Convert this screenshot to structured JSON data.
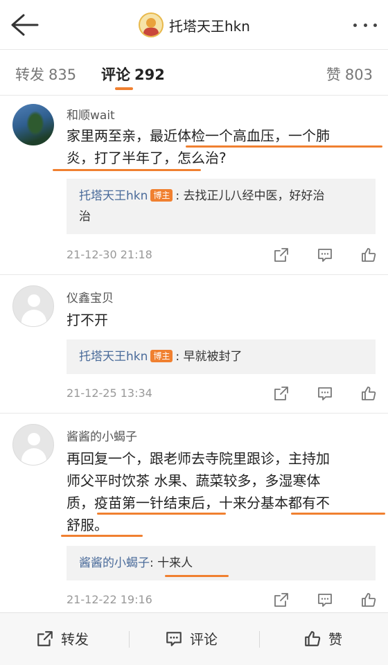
{
  "header": {
    "title": "托塔天王hkn",
    "back_icon": "back-arrow-icon",
    "more_icon": "more-dots-icon"
  },
  "tabs": [
    {
      "label": "转发",
      "count": "835"
    },
    {
      "label": "评论",
      "count": "292"
    },
    {
      "label": "赞",
      "count": "803"
    }
  ],
  "comments": [
    {
      "user": "和顺wait",
      "text_l1": "家里两至亲，最近体检一个高血压，一个肺",
      "text_l2": "炎，打了半年了，怎么治?",
      "reply_name": "托塔天王hkn",
      "reply_badge": "博主",
      "reply_text_l1": ": 去找正儿八经中医，好好治",
      "reply_text_l2": "治",
      "time": "21-12-30 21:18"
    },
    {
      "user": "仪鑫宝贝",
      "text_l1": "打不开",
      "reply_name": "托塔天王hkn",
      "reply_badge": "博主",
      "reply_text_l1": ": 早就被封了",
      "time": "21-12-25 13:34"
    },
    {
      "user": "酱酱的小蝎子",
      "text_l1": "再回复一个，跟老师去寺院里跟诊，主持加",
      "text_l2": "师父平时饮茶 水果、蔬菜较多，多湿寒体",
      "text_l3": "质，疫苗第一针结束后，十来分基本都有不",
      "text_l4": "舒服。",
      "reply_name": "酱酱的小蝎子",
      "reply_text_l1": ": 十来人",
      "time": "21-12-22 19:16"
    }
  ],
  "bottom": {
    "repost": "转发",
    "comment": "评论",
    "like": "赞"
  },
  "colors": {
    "accent": "#f08030",
    "link": "#4a6b9a",
    "muted": "#999999"
  }
}
